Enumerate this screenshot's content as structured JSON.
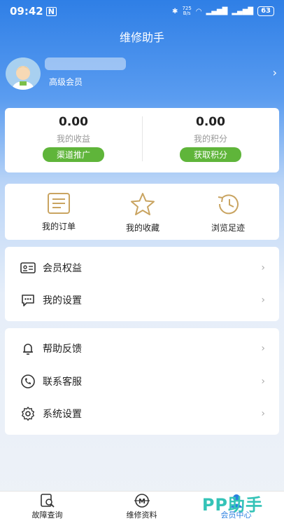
{
  "status_bar": {
    "time": "09:42",
    "network_speed": "725\nB/s",
    "battery": "63"
  },
  "app_title": "维修助手",
  "profile": {
    "member_level": "高级会员"
  },
  "stats": [
    {
      "value": "0.00",
      "label": "我的收益",
      "button": "渠道推广"
    },
    {
      "value": "0.00",
      "label": "我的积分",
      "button": "获取积分"
    }
  ],
  "quick_actions": [
    {
      "label": "我的订单",
      "icon": "order-icon"
    },
    {
      "label": "我的收藏",
      "icon": "star-icon"
    },
    {
      "label": "浏览足迹",
      "icon": "history-icon"
    }
  ],
  "menu_group_1": [
    {
      "label": "会员权益",
      "icon": "member-card-icon"
    },
    {
      "label": "我的设置",
      "icon": "chat-bubbles-icon"
    }
  ],
  "menu_group_2": [
    {
      "label": "帮助反馈",
      "icon": "bell-icon"
    },
    {
      "label": "联系客服",
      "icon": "phone-chat-icon"
    },
    {
      "label": "系统设置",
      "icon": "gear-icon"
    }
  ],
  "tabs": [
    {
      "label": "故障查询",
      "icon": "fault-search-icon",
      "active": false
    },
    {
      "label": "维修资料",
      "icon": "repair-docs-icon",
      "active": false
    },
    {
      "label": "会员中心",
      "icon": "member-center-icon",
      "active": true
    }
  ],
  "colors": {
    "accent": "#2a7fe0",
    "green": "#5fb53a",
    "gold": "#c9a461"
  }
}
